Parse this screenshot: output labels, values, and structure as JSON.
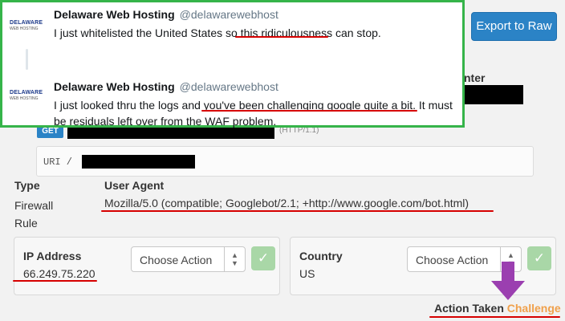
{
  "export_button": "Export to Raw",
  "datacenter_label": "nter",
  "request": {
    "method": "GET",
    "http_version": "(HTTP/1.1)",
    "uri_label": "URI /"
  },
  "type": {
    "label": "Type",
    "value": "Firewall Rule"
  },
  "user_agent": {
    "label": "User Agent",
    "value": "Mozilla/5.0 (compatible; Googlebot/2.1; +http://www.google.com/bot.html)"
  },
  "ip_card": {
    "label": "IP Address",
    "value": "66.249.75.220",
    "select": "Choose Action"
  },
  "country_card": {
    "label": "Country",
    "value": "US",
    "select": "Choose Action"
  },
  "action_taken": {
    "label": "Action Taken",
    "value": "Challenge"
  },
  "tweets": [
    {
      "avatar_top": "DELAWARE",
      "avatar_bottom": "WEB HOSTING",
      "name": "Delaware Web Hosting",
      "handle": "@delawarewebhost",
      "text_before": "I just whitelisted the United States so ",
      "text_highlight": "this ridiculousness",
      "text_after": " can stop."
    },
    {
      "avatar_top": "DELAWARE",
      "avatar_bottom": "WEB HOSTING",
      "name": "Delaware Web Hosting",
      "handle": "@delawarewebhost",
      "text_before": "I just looked thru the logs and ",
      "text_highlight": "you've been challenging google quite a bit.",
      "text_after": " It must be residuals left over from the WAF problem."
    }
  ],
  "colors": {
    "accent_blue": "#2b83c6",
    "overlay_border": "#36b44a",
    "underline_red": "#d60000",
    "challenge_orange": "#f0a04b",
    "arrow_purple": "#9b3fb0"
  }
}
